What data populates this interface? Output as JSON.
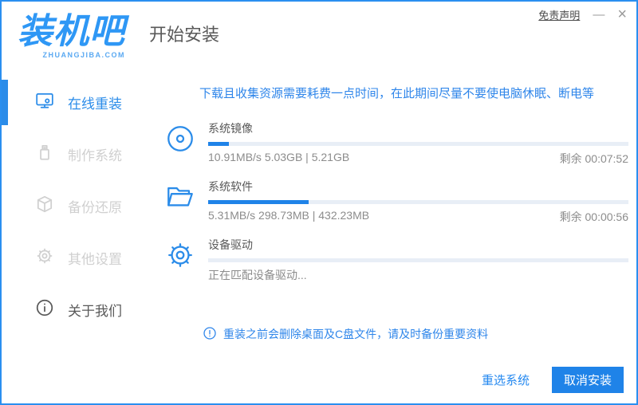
{
  "header": {
    "logo_title": "装机吧",
    "logo_subtitle": "ZHUANGJIBA.COM",
    "page_title": "开始安装",
    "disclaimer_label": "免责声明",
    "minimize_glyph": "—",
    "close_glyph": "×"
  },
  "sidebar": {
    "items": [
      {
        "label": "在线重装",
        "icon": "monitor-icon",
        "active": true
      },
      {
        "label": "制作系统",
        "icon": "usb-icon",
        "active": false
      },
      {
        "label": "备份还原",
        "icon": "backup-box-icon",
        "active": false
      },
      {
        "label": "其他设置",
        "icon": "gear-icon",
        "active": false
      },
      {
        "label": "关于我们",
        "icon": "info-icon",
        "active": false
      }
    ]
  },
  "main": {
    "warning": "下载且收集资源需要耗费一点时间，在此期间尽量不要使电脑休眠、断电等",
    "tasks": [
      {
        "name": "系统镜像",
        "icon": "disc-icon",
        "stats": "10.91MB/s 5.03GB | 5.21GB",
        "remaining": "剩余 00:07:52",
        "progress_percent": 5
      },
      {
        "name": "系统软件",
        "icon": "open-folder-icon",
        "stats": "5.31MB/s 298.73MB | 432.23MB",
        "remaining": "剩余 00:00:56",
        "progress_percent": 24
      },
      {
        "name": "设备驱动",
        "icon": "gear-icon",
        "stats": "正在匹配设备驱动...",
        "remaining": "",
        "progress_percent": 0
      }
    ],
    "note": "重装之前会删除桌面及C盘文件，请及时备份重要资料"
  },
  "footer": {
    "reselect_label": "重选系统",
    "cancel_label": "取消安装"
  },
  "colors": {
    "accent_blue": "#2589f0",
    "button_blue": "#1f83e8",
    "progress_track": "#e8eef6",
    "inactive_gray": "#d0d0d0",
    "text_gray": "#595959",
    "stats_gray": "#8c8c8c"
  }
}
